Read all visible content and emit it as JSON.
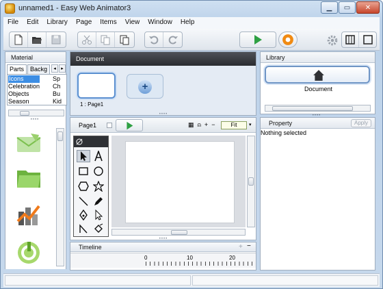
{
  "window": {
    "title": "unnamed1 - Easy Web Animator3"
  },
  "menu": [
    "File",
    "Edit",
    "Library",
    "Page",
    "Items",
    "View",
    "Window",
    "Help"
  ],
  "toolbar": {
    "icons": [
      "new-document-icon",
      "open-folder-icon",
      "save-icon",
      "cut-icon",
      "copy-icon",
      "paste-icon",
      "undo-icon",
      "redo-icon",
      "play-icon",
      "preview-icon",
      "settings-icon",
      "layout-split-icon",
      "layout-single-icon"
    ]
  },
  "material": {
    "header": "Material",
    "tabs": [
      "Parts",
      "Backg"
    ],
    "col1": [
      "Icons",
      "Celebration",
      "Objects",
      "Season"
    ],
    "col2": [
      "Sp",
      "Ch",
      "Bu",
      "Kid"
    ],
    "selected": "Icons",
    "clipart": [
      "envelope-clipart-icon",
      "folder-clipart-icon",
      "chart-clipart-icon",
      "power-clipart-icon"
    ]
  },
  "document": {
    "header": "Document",
    "page_label": "1 : Page1",
    "add_label": "+"
  },
  "stage": {
    "page_name": "Page1",
    "zoom_label": "Fit",
    "zoom_symbols": [
      "▦",
      "⍝",
      "+",
      "−"
    ]
  },
  "timeline": {
    "header": "Timeline",
    "ticks": [
      "0",
      "10",
      "20"
    ],
    "add": "+",
    "remove": "−"
  },
  "library": {
    "header": "Library",
    "item_label": "Document"
  },
  "property": {
    "header": "Property",
    "apply_label": "Apply",
    "status": "Nothing selected"
  },
  "colors": {
    "accent": "#3d8ee4",
    "play": "#2ea043",
    "dark_header": "#2f3135"
  }
}
